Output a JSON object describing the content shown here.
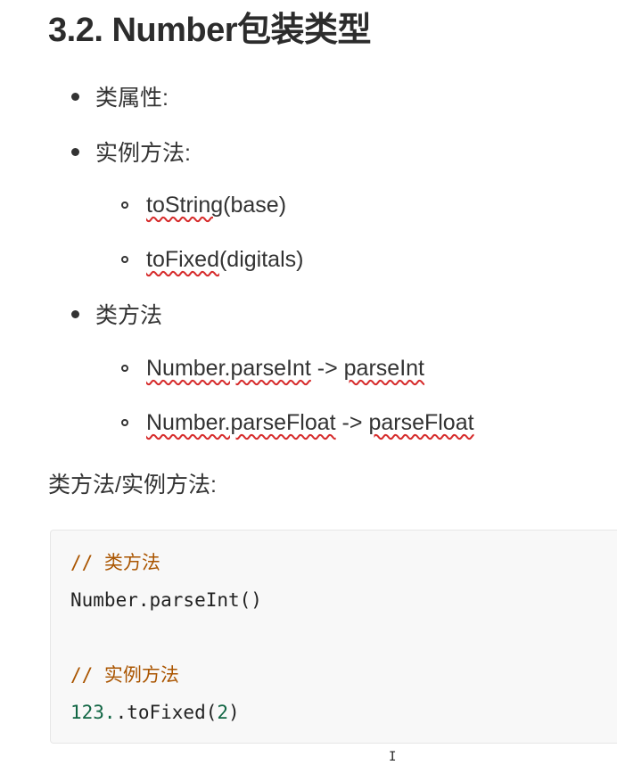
{
  "heading": "3.2. Number包装类型",
  "list": [
    {
      "text": "类属性:",
      "children": []
    },
    {
      "text": "实例方法:",
      "children": [
        {
          "link": "toString",
          "rest": "(base)"
        },
        {
          "link": "toFixed",
          "rest": "(digitals)"
        }
      ]
    },
    {
      "text": "类方法",
      "children": [
        {
          "link": "Number.parseInt",
          "mid": " -> ",
          "link2": "parseInt"
        },
        {
          "link": "Number.parseFloat",
          "mid": " -> ",
          "link2": "parseFloat"
        }
      ]
    }
  ],
  "paragraph": "类方法/实例方法:",
  "code": {
    "line1_comment": "// 类方法",
    "line2_text": "Number.parseInt()",
    "line4_comment": "// 实例方法",
    "line5_num": "123.",
    "line5_text": ".toFixed(",
    "line5_arg": "2",
    "line5_close": ")"
  },
  "cursor_glyph": "I",
  "colors": {
    "spellcheck_underline": "#d62b2b",
    "code_comment": "#aa5500",
    "code_number": "#116644",
    "code_background": "#f8f8f8"
  }
}
